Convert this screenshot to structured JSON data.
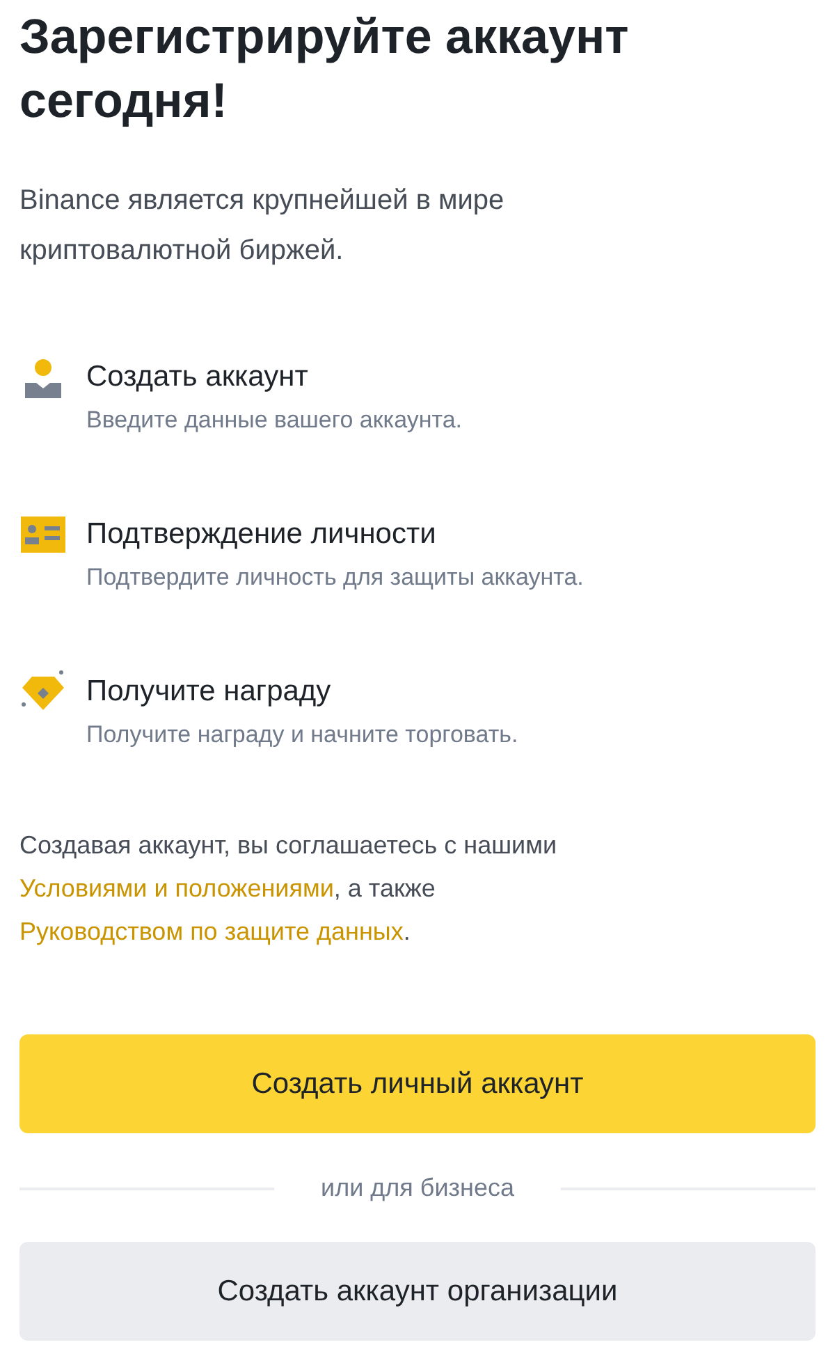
{
  "title": "Зарегистрируйте аккаунт сегодня!",
  "intro": "Binance является крупнейшей в мире криптовалютной биржей.",
  "steps": [
    {
      "title": "Создать аккаунт",
      "subtitle": "Введите данные вашего аккаунта."
    },
    {
      "title": "Подтверждение личности",
      "subtitle": "Подтвердите личность для защиты аккаунта."
    },
    {
      "title": "Получите награду",
      "subtitle": "Получите награду и начните торговать."
    }
  ],
  "terms": [
    {
      "kind": "text",
      "text": "Создавая аккаунт, вы соглашаетесь с нашими "
    },
    {
      "kind": "link",
      "text": "Условиями и положениями"
    },
    {
      "kind": "text",
      "text": ", а также "
    },
    {
      "kind": "link",
      "text": "Руководством по защите данных"
    },
    {
      "kind": "text",
      "text": "."
    }
  ],
  "primary_button": "Создать личный аккаунт",
  "divider_label": "или для бизнеса",
  "secondary_button": "Создать аккаунт организации"
}
